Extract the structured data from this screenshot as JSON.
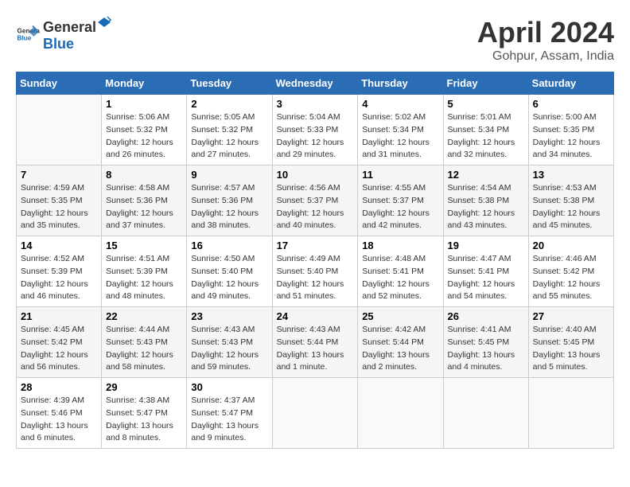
{
  "header": {
    "logo_general": "General",
    "logo_blue": "Blue",
    "month": "April 2024",
    "location": "Gohpur, Assam, India"
  },
  "days_of_week": [
    "Sunday",
    "Monday",
    "Tuesday",
    "Wednesday",
    "Thursday",
    "Friday",
    "Saturday"
  ],
  "weeks": [
    [
      {
        "day": "",
        "info": ""
      },
      {
        "day": "1",
        "info": "Sunrise: 5:06 AM\nSunset: 5:32 PM\nDaylight: 12 hours\nand 26 minutes."
      },
      {
        "day": "2",
        "info": "Sunrise: 5:05 AM\nSunset: 5:32 PM\nDaylight: 12 hours\nand 27 minutes."
      },
      {
        "day": "3",
        "info": "Sunrise: 5:04 AM\nSunset: 5:33 PM\nDaylight: 12 hours\nand 29 minutes."
      },
      {
        "day": "4",
        "info": "Sunrise: 5:02 AM\nSunset: 5:34 PM\nDaylight: 12 hours\nand 31 minutes."
      },
      {
        "day": "5",
        "info": "Sunrise: 5:01 AM\nSunset: 5:34 PM\nDaylight: 12 hours\nand 32 minutes."
      },
      {
        "day": "6",
        "info": "Sunrise: 5:00 AM\nSunset: 5:35 PM\nDaylight: 12 hours\nand 34 minutes."
      }
    ],
    [
      {
        "day": "7",
        "info": "Sunrise: 4:59 AM\nSunset: 5:35 PM\nDaylight: 12 hours\nand 35 minutes."
      },
      {
        "day": "8",
        "info": "Sunrise: 4:58 AM\nSunset: 5:36 PM\nDaylight: 12 hours\nand 37 minutes."
      },
      {
        "day": "9",
        "info": "Sunrise: 4:57 AM\nSunset: 5:36 PM\nDaylight: 12 hours\nand 38 minutes."
      },
      {
        "day": "10",
        "info": "Sunrise: 4:56 AM\nSunset: 5:37 PM\nDaylight: 12 hours\nand 40 minutes."
      },
      {
        "day": "11",
        "info": "Sunrise: 4:55 AM\nSunset: 5:37 PM\nDaylight: 12 hours\nand 42 minutes."
      },
      {
        "day": "12",
        "info": "Sunrise: 4:54 AM\nSunset: 5:38 PM\nDaylight: 12 hours\nand 43 minutes."
      },
      {
        "day": "13",
        "info": "Sunrise: 4:53 AM\nSunset: 5:38 PM\nDaylight: 12 hours\nand 45 minutes."
      }
    ],
    [
      {
        "day": "14",
        "info": "Sunrise: 4:52 AM\nSunset: 5:39 PM\nDaylight: 12 hours\nand 46 minutes."
      },
      {
        "day": "15",
        "info": "Sunrise: 4:51 AM\nSunset: 5:39 PM\nDaylight: 12 hours\nand 48 minutes."
      },
      {
        "day": "16",
        "info": "Sunrise: 4:50 AM\nSunset: 5:40 PM\nDaylight: 12 hours\nand 49 minutes."
      },
      {
        "day": "17",
        "info": "Sunrise: 4:49 AM\nSunset: 5:40 PM\nDaylight: 12 hours\nand 51 minutes."
      },
      {
        "day": "18",
        "info": "Sunrise: 4:48 AM\nSunset: 5:41 PM\nDaylight: 12 hours\nand 52 minutes."
      },
      {
        "day": "19",
        "info": "Sunrise: 4:47 AM\nSunset: 5:41 PM\nDaylight: 12 hours\nand 54 minutes."
      },
      {
        "day": "20",
        "info": "Sunrise: 4:46 AM\nSunset: 5:42 PM\nDaylight: 12 hours\nand 55 minutes."
      }
    ],
    [
      {
        "day": "21",
        "info": "Sunrise: 4:45 AM\nSunset: 5:42 PM\nDaylight: 12 hours\nand 56 minutes."
      },
      {
        "day": "22",
        "info": "Sunrise: 4:44 AM\nSunset: 5:43 PM\nDaylight: 12 hours\nand 58 minutes."
      },
      {
        "day": "23",
        "info": "Sunrise: 4:43 AM\nSunset: 5:43 PM\nDaylight: 12 hours\nand 59 minutes."
      },
      {
        "day": "24",
        "info": "Sunrise: 4:43 AM\nSunset: 5:44 PM\nDaylight: 13 hours\nand 1 minute."
      },
      {
        "day": "25",
        "info": "Sunrise: 4:42 AM\nSunset: 5:44 PM\nDaylight: 13 hours\nand 2 minutes."
      },
      {
        "day": "26",
        "info": "Sunrise: 4:41 AM\nSunset: 5:45 PM\nDaylight: 13 hours\nand 4 minutes."
      },
      {
        "day": "27",
        "info": "Sunrise: 4:40 AM\nSunset: 5:45 PM\nDaylight: 13 hours\nand 5 minutes."
      }
    ],
    [
      {
        "day": "28",
        "info": "Sunrise: 4:39 AM\nSunset: 5:46 PM\nDaylight: 13 hours\nand 6 minutes."
      },
      {
        "day": "29",
        "info": "Sunrise: 4:38 AM\nSunset: 5:47 PM\nDaylight: 13 hours\nand 8 minutes."
      },
      {
        "day": "30",
        "info": "Sunrise: 4:37 AM\nSunset: 5:47 PM\nDaylight: 13 hours\nand 9 minutes."
      },
      {
        "day": "",
        "info": ""
      },
      {
        "day": "",
        "info": ""
      },
      {
        "day": "",
        "info": ""
      },
      {
        "day": "",
        "info": ""
      }
    ]
  ]
}
